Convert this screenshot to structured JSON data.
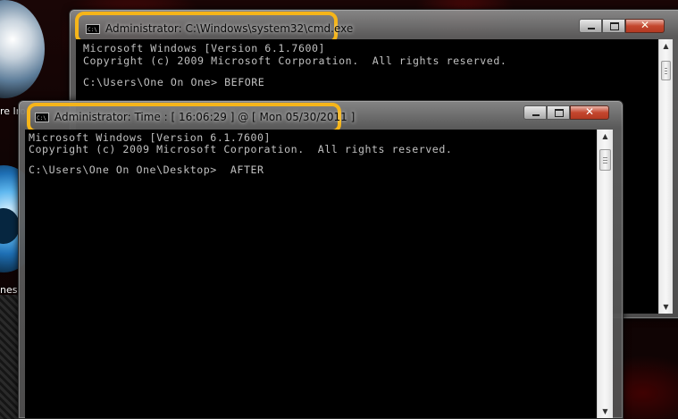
{
  "desktop": {
    "icon_labels": [
      "re Iro",
      "nes"
    ]
  },
  "window_back": {
    "title": "Administrator: C:\\Windows\\system32\\cmd.exe",
    "icon_text": "C:\\",
    "lines": [
      "Microsoft Windows [Version 6.1.7600]",
      "Copyright (c) 2009 Microsoft Corporation.  All rights reserved.",
      "",
      "C:\\Users\\One On One> BEFORE"
    ],
    "controls": {
      "minimize": "minimize",
      "maximize": "maximize",
      "close": "✕"
    }
  },
  "window_front": {
    "title": "Administrator:  Time : [ 16:06:29 ] @ [ Mon 05/30/2011 ]",
    "icon_text": "C:\\",
    "lines": [
      "Microsoft Windows [Version 6.1.7600]",
      "Copyright (c) 2009 Microsoft Corporation.  All rights reserved.",
      "",
      "C:\\Users\\One On One\\Desktop>  AFTER"
    ],
    "controls": {
      "minimize": "minimize",
      "maximize": "maximize",
      "close": "✕"
    }
  },
  "scrollbar": {
    "up": "▲",
    "down": "▼"
  },
  "colors": {
    "highlight": "#f6b519",
    "console_bg": "#000000",
    "console_text": "#c0c0c0"
  }
}
